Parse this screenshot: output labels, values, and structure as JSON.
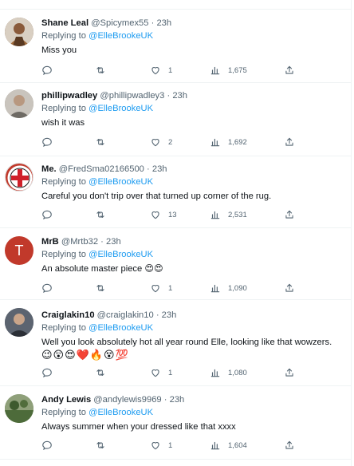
{
  "replying_prefix": "Replying to",
  "replies": [
    {
      "name": "Shane Leal",
      "handle": "@Spicymex55",
      "time": "23h",
      "replying_to": "@ElleBrookeUK",
      "text": "Miss you",
      "comments": "",
      "retweets": "",
      "likes": "1",
      "views": "1,675",
      "avatar_color": "#6b4a2e"
    },
    {
      "name": "phillipwadley",
      "handle": "@phillipwadley3",
      "time": "23h",
      "replying_to": "@ElleBrookeUK",
      "text": "wish it was",
      "comments": "",
      "retweets": "",
      "likes": "2",
      "views": "1,692",
      "avatar_color": "#8a8278"
    },
    {
      "name": "Me.",
      "handle": "@FredSma02166500",
      "time": "23h",
      "replying_to": "@ElleBrookeUK",
      "text": "Careful you don't trip over that turned up corner of the rug.",
      "comments": "",
      "retweets": "",
      "likes": "13",
      "views": "2,531",
      "avatar_color": "#ffffff"
    },
    {
      "name": "MrB",
      "handle": "@Mrtb32",
      "time": "23h",
      "replying_to": "@ElleBrookeUK",
      "text": "An absolute master piece 😍😍",
      "comments": "",
      "retweets": "",
      "likes": "1",
      "views": "1,090",
      "avatar_letter": "T",
      "avatar_color": "#c1392b"
    },
    {
      "name": "Craiglakin10",
      "handle": "@craiglakin10",
      "time": "23h",
      "replying_to": "@ElleBrookeUK",
      "text": "Well you look absolutely hot all year round Elle, looking like that wowzers.",
      "text2": "😉😲😍❤️🔥😵💯",
      "comments": "",
      "retweets": "",
      "likes": "1",
      "views": "1,080",
      "avatar_color": "#4a4f57"
    },
    {
      "name": "Andy Lewis",
      "handle": "@andylewis9969",
      "time": "23h",
      "replying_to": "@ElleBrookeUK",
      "text": "Always summer when your dressed like that xxxx",
      "comments": "",
      "retweets": "",
      "likes": "1",
      "views": "1,604",
      "avatar_color": "#5f7a4a"
    }
  ],
  "colors": {
    "text": "#0f1419",
    "secondary": "#536471",
    "link": "#1d9bf0",
    "divider": "#eff3f4"
  }
}
